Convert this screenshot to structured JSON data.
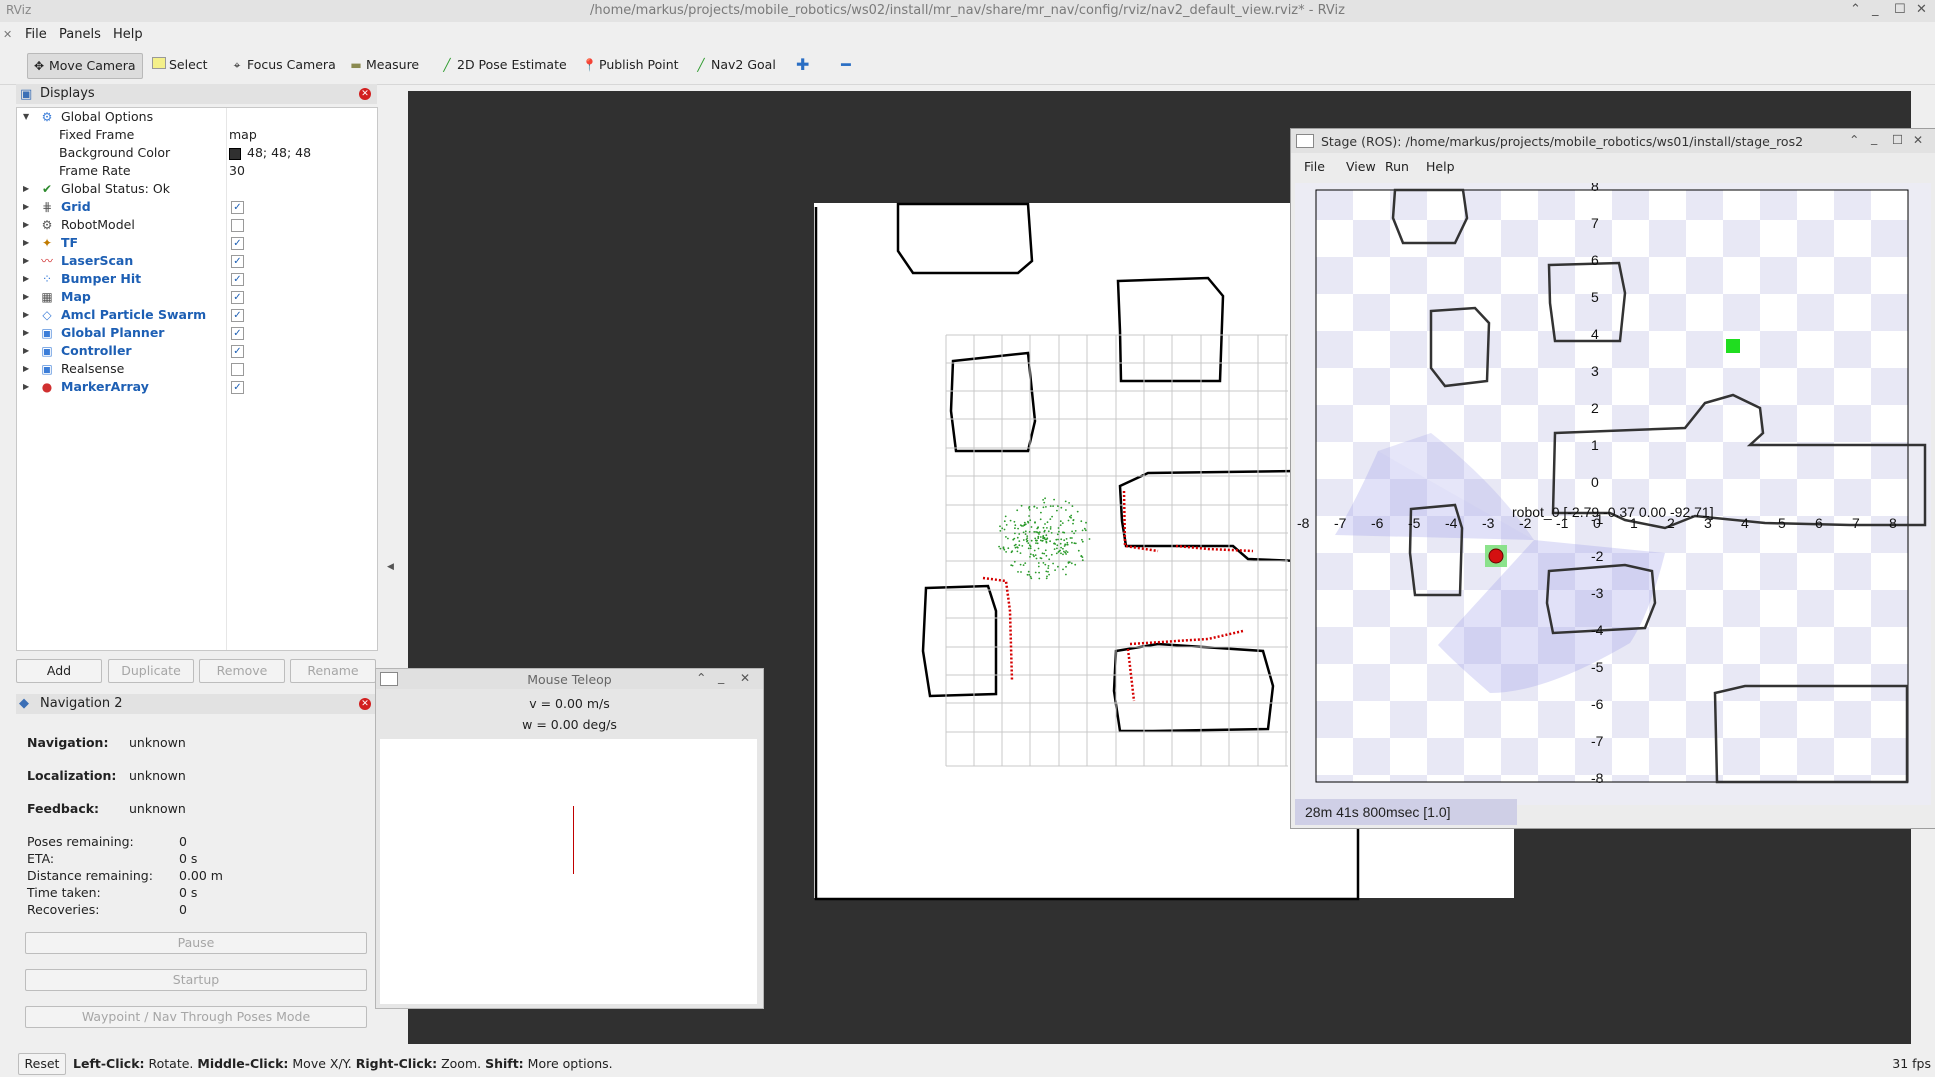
{
  "window": {
    "title": "/home/markus/projects/mobile_robotics/ws02/install/mr_nav/share/mr_nav/config/rviz/nav2_default_view.rviz* - RViz",
    "app_icon": "RViz"
  },
  "menu": [
    "File",
    "Panels",
    "Help"
  ],
  "toolbar": {
    "tools": [
      {
        "label": "Move Camera",
        "icon": "move-camera-icon"
      },
      {
        "label": "Select",
        "icon": "select-icon"
      },
      {
        "label": "Focus Camera",
        "icon": "focus-camera-icon"
      },
      {
        "label": "Measure",
        "icon": "measure-icon"
      },
      {
        "label": "2D Pose Estimate",
        "icon": "pose-estimate-icon"
      },
      {
        "label": "Publish Point",
        "icon": "publish-point-icon"
      },
      {
        "label": "Nav2 Goal",
        "icon": "nav2-goal-icon"
      }
    ]
  },
  "displays": {
    "title": "Displays",
    "global_options": "Global Options",
    "fixed_frame_label": "Fixed Frame",
    "fixed_frame_value": "map",
    "bg_color_label": "Background Color",
    "bg_color_value": "48; 48; 48",
    "frame_rate_label": "Frame Rate",
    "frame_rate_value": "30",
    "global_status": "Global Status: Ok",
    "items": [
      {
        "label": "Grid",
        "checked": true,
        "blue": true
      },
      {
        "label": "RobotModel",
        "checked": false,
        "blue": false
      },
      {
        "label": "TF",
        "checked": true,
        "blue": true
      },
      {
        "label": "LaserScan",
        "checked": true,
        "blue": true
      },
      {
        "label": "Bumper Hit",
        "checked": true,
        "blue": true
      },
      {
        "label": "Map",
        "checked": true,
        "blue": true
      },
      {
        "label": "Amcl Particle Swarm",
        "checked": true,
        "blue": true
      },
      {
        "label": "Global Planner",
        "checked": true,
        "blue": true
      },
      {
        "label": "Controller",
        "checked": true,
        "blue": true
      },
      {
        "label": "Realsense",
        "checked": false,
        "blue": false
      },
      {
        "label": "MarkerArray",
        "checked": true,
        "blue": true
      }
    ],
    "buttons": {
      "add": "Add",
      "duplicate": "Duplicate",
      "remove": "Remove",
      "rename": "Rename"
    }
  },
  "navigation": {
    "title": "Navigation 2",
    "navigation_label": "Navigation:",
    "navigation_value": "unknown",
    "localization_label": "Localization:",
    "localization_value": "unknown",
    "feedback_label": "Feedback:",
    "feedback_value": "unknown",
    "poses_label": "Poses remaining:",
    "poses_value": "0",
    "eta_label": "ETA:",
    "eta_value": "0 s",
    "distance_label": "Distance remaining:",
    "distance_value": "0.00 m",
    "time_label": "Time taken:",
    "time_value": "0 s",
    "recoveries_label": "Recoveries:",
    "recoveries_value": "0",
    "pause": "Pause",
    "startup": "Startup",
    "waypoint": "Waypoint / Nav Through Poses Mode"
  },
  "teleop": {
    "title": "Mouse Teleop",
    "v": "v = 0.00 m/s",
    "w": "w = 0.00 deg/s"
  },
  "stage": {
    "title": "Stage (ROS): /home/markus/projects/mobile_robotics/ws01/install/stage_ros2",
    "menu": [
      "File",
      "View",
      "Run",
      "Help"
    ],
    "robot_label": "robot_0 [-2.79 -0.37 0.00 -92.71]",
    "x_ticks": [
      "-8",
      "-7",
      "-6",
      "-5",
      "-4",
      "-3",
      "-2",
      "-1",
      "0",
      "1",
      "2",
      "3",
      "4",
      "5",
      "6",
      "7",
      "8"
    ],
    "y_ticks": [
      "8",
      "7",
      "6",
      "5",
      "4",
      "3",
      "2",
      "1",
      "0",
      "-1",
      "-2",
      "-3",
      "-4",
      "-5",
      "-6",
      "-7",
      "-8"
    ],
    "status": "28m 41s 800msec [1.0]"
  },
  "statusbar": {
    "reset": "Reset",
    "left_click_b": "Left-Click:",
    "left_click": " Rotate. ",
    "middle_click_b": "Middle-Click:",
    "middle_click": " Move X/Y. ",
    "right_click_b": "Right-Click:",
    "right_click": " Zoom. ",
    "shift_b": "Shift:",
    "shift": " More options.",
    "fps": "31 fps"
  },
  "colors": {
    "background": "#303030",
    "accent": "#1d5fb4",
    "laser": "#d40000",
    "goal": "#20dd20"
  }
}
